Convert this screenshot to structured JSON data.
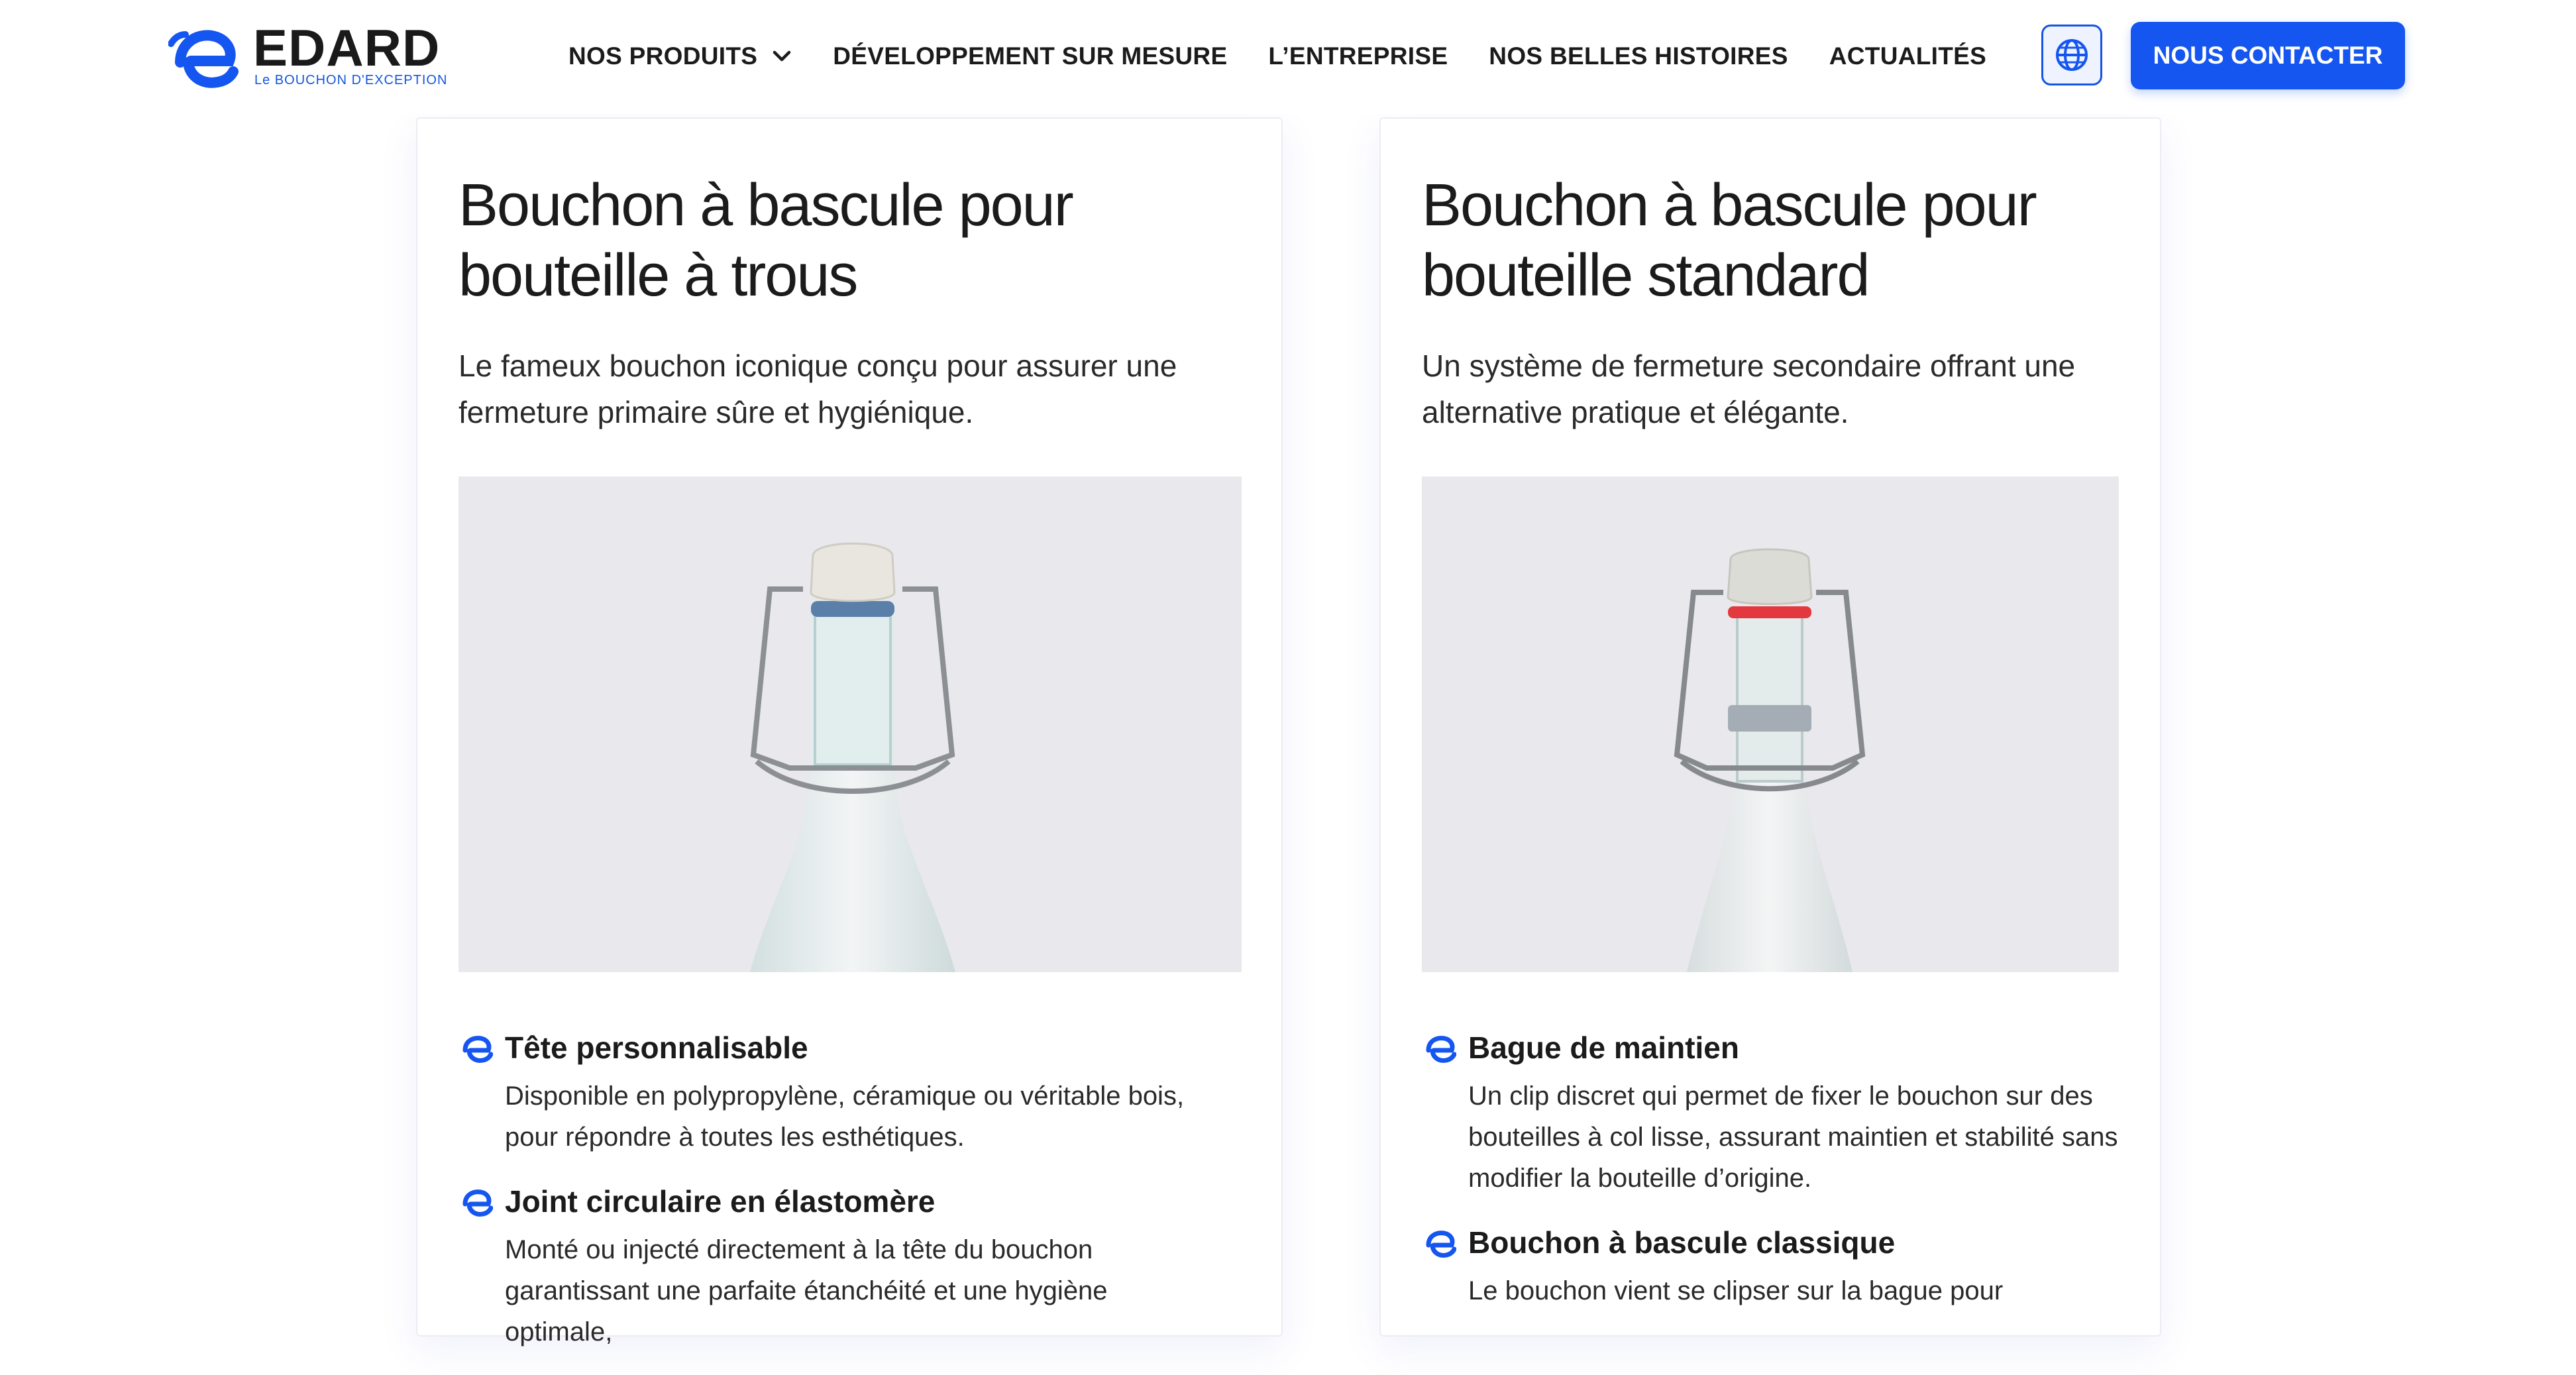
{
  "brand": {
    "name": "EDARD",
    "tagline": "Le BOUCHON D'EXCEPTION",
    "accent_color": "#1556f0"
  },
  "nav": {
    "items": [
      {
        "label": "NOS PRODUITS",
        "has_dropdown": true
      },
      {
        "label": "DÉVELOPPEMENT SUR MESURE"
      },
      {
        "label": "L’ENTREPRISE"
      },
      {
        "label": "NOS BELLES HISTOIRES"
      },
      {
        "label": "ACTUALITÉS"
      }
    ],
    "language_icon": "globe-icon",
    "contact_label": "NOUS CONTACTER"
  },
  "cards": [
    {
      "title": "Bouchon à bascule pour bouteille à trous",
      "description": "Le fameux bouchon iconique conçu pour assurer une fermeture primaire sûre et hygiénique.",
      "image_subject": "swing-top bottle with blue gasket",
      "features": [
        {
          "icon": "edard-logo-icon",
          "title": "Tête personnalisable",
          "text": "Disponible en polypropylène, céramique ou véritable bois, pour répondre à toutes les esthétiques."
        },
        {
          "icon": "edard-logo-icon",
          "title": "Joint circulaire en élastomère",
          "text": "Monté ou injecté directement à la tête du bouchon garantissant une parfaite étanchéité et une hygiène optimale,"
        }
      ]
    },
    {
      "title": "Bouchon à bascule pour bouteille standard",
      "description": "Un système de fermeture secondaire offrant une alternative pratique et élégante.",
      "image_subject": "swing-top bottle with red gasket and retaining ring",
      "features": [
        {
          "icon": "edard-logo-icon",
          "title": "Bague de maintien",
          "text": "Un clip discret qui permet de fixer le bouchon sur des bouteilles à col lisse, assurant maintien et stabilité sans modifier la bouteille d’origine."
        },
        {
          "icon": "edard-logo-icon",
          "title": "Bouchon à bascule classique",
          "text": "Le bouchon vient se clipser sur la bague pour"
        }
      ]
    }
  ]
}
